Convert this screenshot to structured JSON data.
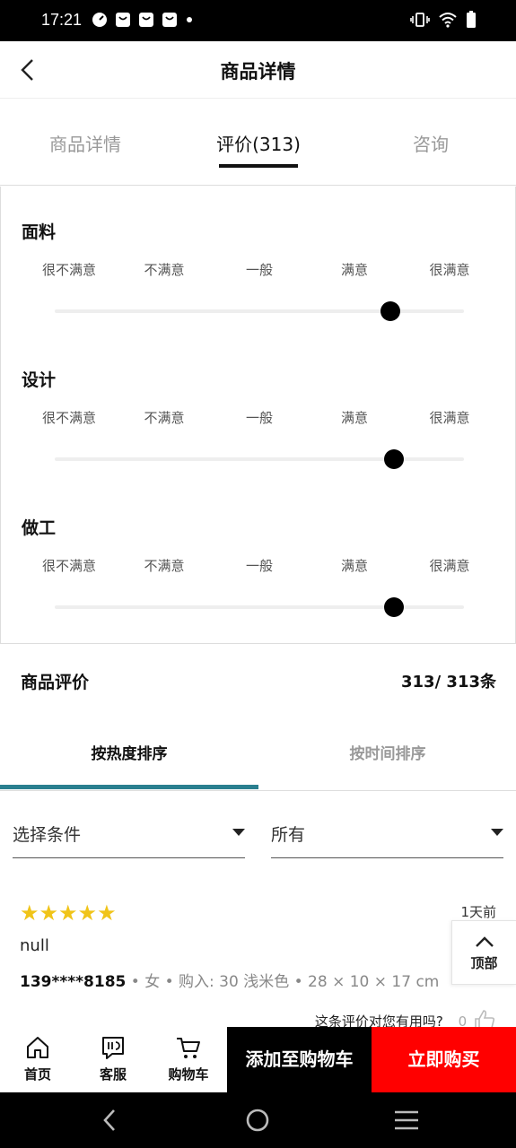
{
  "status_bar": {
    "time": "17:21"
  },
  "header": {
    "title": "商品详情"
  },
  "tabs": [
    {
      "label": "商品详情",
      "active": false
    },
    {
      "label": "评价(313)",
      "active": true
    },
    {
      "label": "咨询",
      "active": false
    }
  ],
  "rating_scale": [
    "很不满意",
    "不满意",
    "一般",
    "满意",
    "很满意"
  ],
  "ratings": [
    {
      "title": "面料",
      "level": 0.82
    },
    {
      "title": "设计",
      "level": 0.83
    },
    {
      "title": "做工",
      "level": 0.83
    }
  ],
  "reviews_section": {
    "title": "商品评价",
    "count": "313/ 313条"
  },
  "sort_tabs": [
    {
      "label": "按热度排序",
      "active": true
    },
    {
      "label": "按时间排序",
      "active": false
    }
  ],
  "filters": {
    "condition": "选择条件",
    "scope": "所有"
  },
  "review": {
    "stars": "★★★★★",
    "rating": 5,
    "time": "1天前",
    "text": "null",
    "user": "139****8185",
    "meta": " • 女 • 购入: 30 浅米色 • 28 × 10 × 17 cm",
    "helpful_question": "这条评价对您有用吗?",
    "helpful_count": "0"
  },
  "top_button": {
    "label": "顶部"
  },
  "bottom_nav": {
    "home": "首页",
    "service": "客服",
    "cart": "购物车",
    "add_to_cart": "添加至购物车",
    "buy_now": "立即购买"
  },
  "colors": {
    "accent_teal": "#2a7f8f",
    "buy_red": "#ff0000",
    "star_yellow": "#f0c419"
  }
}
